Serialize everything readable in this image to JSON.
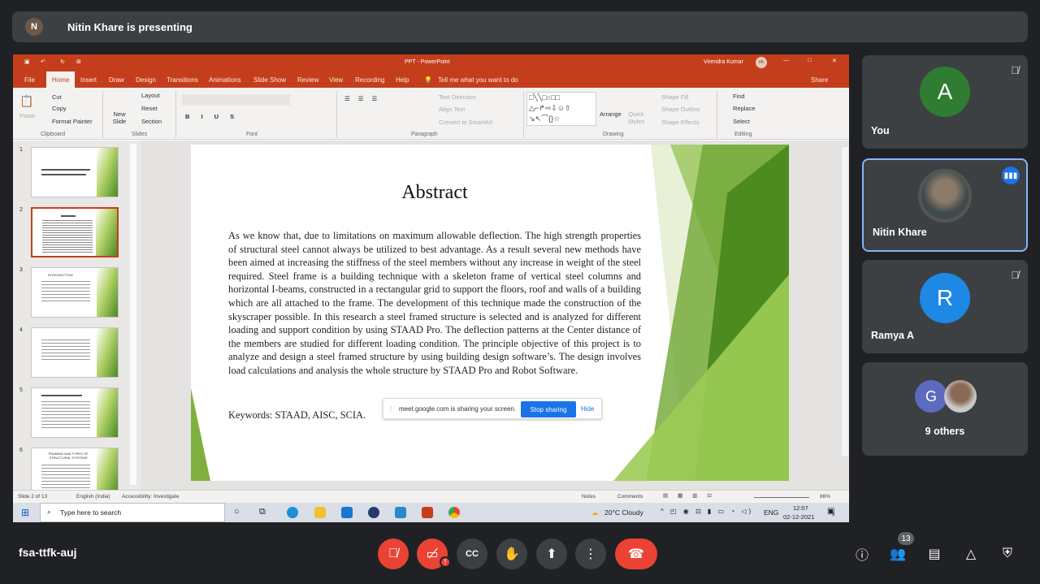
{
  "banner": {
    "presenter_initials": "N",
    "presenting_text": "Nitin Khare is presenting"
  },
  "ppt": {
    "window_title": "PPT - PowerPoint",
    "user_name": "Virendra Kumar",
    "user_initials": "VK",
    "tabs": [
      "File",
      "Home",
      "Insert",
      "Draw",
      "Design",
      "Transitions",
      "Animations",
      "Slide Show",
      "Review",
      "View",
      "Recording",
      "Help"
    ],
    "tell_me": "Tell me what you want to do",
    "share_label": "Share",
    "ribbon": {
      "paste": "Paste",
      "cut": "Cut",
      "copy": "Copy",
      "format_painter": "Format Painter",
      "clipboard": "Clipboard",
      "new_slide": "New Slide",
      "layout": "Layout",
      "reset": "Reset",
      "section": "Section",
      "slides": "Slides",
      "font": "Font",
      "paragraph": "Paragraph",
      "text_direction": "Text Direction",
      "align_text": "Align Text",
      "convert": "Convert to SmartArt",
      "arrange": "Arrange",
      "quick_styles": "Quick Styles",
      "shape_fill": "Shape Fill",
      "shape_outline": "Shape Outline",
      "shape_effects": "Shape Effects",
      "drawing": "Drawing",
      "find": "Find",
      "replace": "Replace",
      "select": "Select",
      "editing": "Editing"
    },
    "thumbs": [
      "1",
      "2",
      "3",
      "4",
      "5",
      "6"
    ],
    "thumb_titles": [
      "",
      "",
      "INTRODUCTION",
      "",
      "",
      "FRAMING AND TYPES OF STRUCTURAL SYSTEMS"
    ],
    "slide": {
      "title": "Abstract",
      "body": "As we know that, due to limitations on maximum allowable deflection. The high strength properties of structural steel cannot always be utilized to best advantage. As a result several new methods have been aimed at increasing the stiffness of the steel members without any increase in weight of the steel required. Steel frame is a building technique with a skeleton frame of vertical steel columns and horizontal I-beams, constructed in a rectangular grid to support the floors, roof and walls of a building which are all attached to the frame. The development of this technique made the construction of the skyscraper possible. In this research a steel framed structure is selected and is analyzed for different loading and support condition by using STAAD Pro. The deflection patterns at the Center distance of the members are studied for different loading condition. The principle objective of this project is to analyze and design a steel framed structure by using building design software’s. The design involves load calculations and analysis the whole structure by STAAD Pro and Robot Software.",
      "keywords": "Keywords: STAAD, AISC, SCIA."
    },
    "share_notice": {
      "text": "meet.google.com is sharing your screen.",
      "stop": "Stop sharing",
      "hide": "Hide"
    },
    "status": {
      "slide_of": "Slide 2 of 13",
      "language": "English (India)",
      "accessibility": "Accessibility: Investigate",
      "notes": "Notes",
      "comments": "Comments",
      "zoom": "86%"
    }
  },
  "taskbar": {
    "search_placeholder": "Type here to search",
    "weather": "20°C  Cloudy",
    "lang": "ENG",
    "time": "12:07",
    "date": "02-12-2021",
    "notif_count": "5"
  },
  "participants": [
    {
      "name": "You",
      "initial": "A",
      "color": "#2e7d32",
      "muted": true
    },
    {
      "name": "Nitin Khare",
      "initial": "N",
      "color": "#5b6b6b",
      "muted": false
    },
    {
      "name": "Ramya A",
      "initial": "R",
      "color": "#1e88e5",
      "muted": true
    }
  ],
  "others": {
    "label": "9 others",
    "initial": "G"
  },
  "meeting_code": "fsa-ttfk-auj",
  "people_count": "13",
  "colors": {
    "end_call": "#ea4335",
    "active_speaker": "#8ab4f8"
  }
}
